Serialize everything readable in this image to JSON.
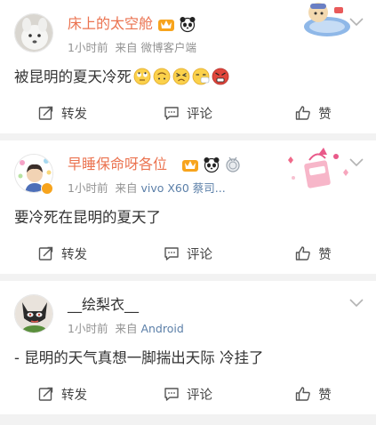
{
  "posts": [
    {
      "username": "床上的太空舱",
      "time": "1小时前",
      "source_prefix": "来自",
      "source": "微博客户端",
      "content": "被昆明的夏天冷死",
      "emojis": [
        "eyeroll-emoji",
        "upside-down-emoji",
        "tired-emoji",
        "sneeze-emoji",
        "angry-emoji"
      ],
      "actions": {
        "repost": "转发",
        "comment": "评论",
        "like": "赞"
      }
    },
    {
      "username": "早睡保命呀各位",
      "time": "1小时前",
      "source_prefix": "来自",
      "source": "vivo X60 蔡司...",
      "content": "要冷死在昆明的夏天了",
      "actions": {
        "repost": "转发",
        "comment": "评论",
        "like": "赞"
      }
    },
    {
      "username": "__绘梨衣__",
      "time": "1小时前",
      "source_prefix": "来自",
      "source": "Android",
      "content": "- 昆明的天气真想一脚揣出天际 冷挂了",
      "actions": {
        "repost": "转发",
        "comment": "评论",
        "like": "赞"
      }
    }
  ],
  "colors": {
    "vip_name": "#eb7350",
    "meta": "#939393",
    "source_link": "#5b7fa8",
    "separator": "#f2f2f2"
  }
}
